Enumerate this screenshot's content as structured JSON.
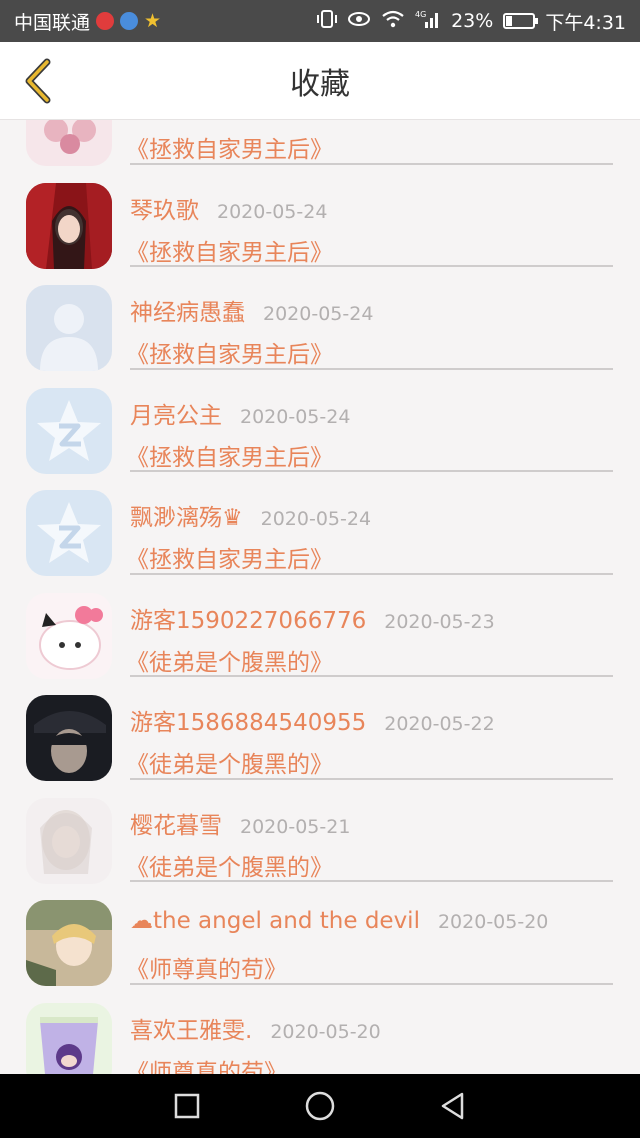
{
  "status_bar": {
    "carrier": "中国联通",
    "battery_pct": "23%",
    "battery_level": 0.23,
    "time": "下午4:31",
    "network": "4G"
  },
  "header": {
    "title": "收藏",
    "back_icon": "chevron-left-icon",
    "accent": "#e8b830"
  },
  "items": [
    {
      "user": "",
      "date": "",
      "book": "《拯救自家男主后》",
      "avatar": "photo-pink"
    },
    {
      "user": "琴玖歌",
      "date": "2020-05-24",
      "book": "《拯救自家男主后》",
      "avatar": "photo-red"
    },
    {
      "user": "神经病愚蠢",
      "date": "2020-05-24",
      "book": "《拯救自家男主后》",
      "avatar": "default-person"
    },
    {
      "user": "月亮公主",
      "date": "2020-05-24",
      "book": "《拯救自家男主后》",
      "avatar": "default-star"
    },
    {
      "user": "飘渺漓殇♛",
      "date": "2020-05-24",
      "book": "《拯救自家男主后》",
      "avatar": "default-star"
    },
    {
      "user": "游客1590227066776",
      "date": "2020-05-23",
      "book": "《徒弟是个腹黑的》",
      "avatar": "photo-kitty"
    },
    {
      "user": "游客1586884540955",
      "date": "2020-05-22",
      "book": "《徒弟是个腹黑的》",
      "avatar": "photo-dark"
    },
    {
      "user": "樱花暮雪",
      "date": "2020-05-21",
      "book": "《徒弟是个腹黑的》",
      "avatar": "photo-light"
    },
    {
      "user": "☁the angel and the devil",
      "date": "2020-05-20",
      "book": "《师尊真的苟》",
      "avatar": "photo-anime"
    },
    {
      "user": "喜欢王雅雯.",
      "date": "2020-05-20",
      "book": "《师尊真的苟》",
      "avatar": "photo-cup"
    }
  ],
  "colors": {
    "name_text": "#e8855a",
    "date_text": "#b3b0b0",
    "background": "#f6f4f4"
  },
  "nav": {
    "recent_icon": "square-icon",
    "home_icon": "circle-icon",
    "back_icon": "triangle-back-icon"
  }
}
